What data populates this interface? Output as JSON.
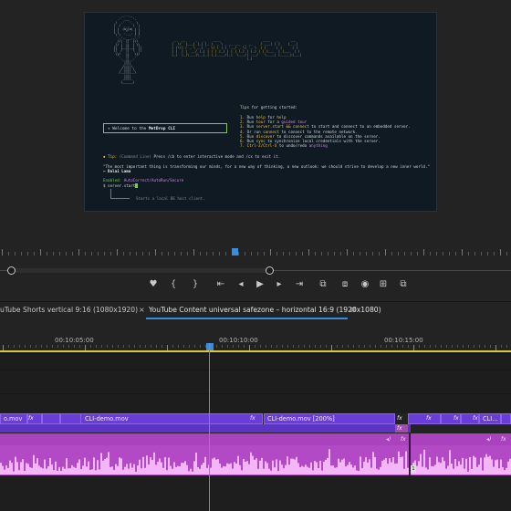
{
  "monitor": {
    "ascii_art": "          .-'''-.\n        .'  ___  '.\n       /  .'   '.  \\\n      |  /  _ _  \\  |\n      | |  (o)(o) | |\n      | |    ^    | |\n       \\ \\  '---' / /\n        '.'-.___.-'.'\n        //|  ||  |\\\\\n       // |  ||  | \\\\\n      ||  |__||__|  ||\n      ||  /  ||  \\  ||\n       \\\\/   ||   \\//\n        '.   ||   .'\n          '-.||.-'\n            ||||\n           /||||\\\n          / |||| \\\n         /__||||__\\\n            ||||\n           _||||_\n          (______)",
    "banner_art": " __  __     _   _    ____                     ____   _      ___ \n|  \\/  |___| |_| |_ |  _ \\ _ __ ___  _ __    / ___| | |    |_ _|\n| |\\/| / _ \\ __| '_ \\| | | | '__/ _ \\| '_ \\  | |     | |     | | \n| |  | |  __/ |_| | | | |_| | | | (_) | |_) | | |___  | |___  | | \n|_|  |_|\\___|\\__|_| |_|____/|_|  \\___/| .__/   \\____| |_____||___|\n                                      |_|                        ",
    "welcome_prefix": "✳ Welcome to the ",
    "welcome_bold": "MetDrop CLI",
    "tips_title": "Tips for getting started:",
    "tips": [
      {
        "n": "1.",
        "a": "Run ",
        "cmd": "help",
        "b": " for ",
        "c": "help",
        "cls": "hi"
      },
      {
        "n": "2.",
        "a": "Run ",
        "cmd": "tour",
        "b": " for a ",
        "c": "guided tour",
        "cls": "pur"
      },
      {
        "n": "3.",
        "a": "Run ",
        "cmd": "server.start && connect",
        "b": " to start and connect to an embedded server.",
        "c": "",
        "cls": ""
      },
      {
        "n": "4.",
        "a": "Or run ",
        "cmd": "connect",
        "b": " to connect to the remote network.",
        "c": "",
        "cls": ""
      },
      {
        "n": "5.",
        "a": "Run ",
        "cmd": "discover",
        "b": " to discover commands available on the server.",
        "c": "",
        "cls": ""
      },
      {
        "n": "6.",
        "a": "Run ",
        "cmd": "sync",
        "b": " to synchronize local credentials with the server.",
        "c": "",
        "cls": ""
      },
      {
        "n": "7.",
        "a": "",
        "cmd": "Ctrl-Z/Ctrl-X",
        "b": " to undo/redo ",
        "c": "anything",
        "cls": "pur"
      }
    ],
    "tip_line_a": "◆ Tip: ",
    "tip_line_b": "(Command Line) ",
    "tip_line_c": "Press /cb to enter interactive mode and /cx to exit it.",
    "quote": "\"The most important thing is transforming our minds, for a new way of thinking, a new outlook: we should strive to develop a new inner world.\"",
    "author": "— Dalai Lama",
    "enabled_label": "Enabled: ",
    "enabled_value": "AutoCorrect/AutoRun/Secure",
    "prompt": "$ server.start",
    "tree_label": "Starts a local BE host client."
  },
  "transport": {
    "icons": [
      "marker-icon",
      "mark-in-icon",
      "mark-out-icon",
      "go-to-in-icon",
      "step-back-icon",
      "play-icon",
      "step-forward-icon",
      "go-to-out-icon",
      "lift-icon",
      "extract-icon",
      "export-frame-icon",
      "compare-icon",
      "settings-icon"
    ],
    "glyphs": [
      "♥",
      "{",
      "}",
      "⇤",
      "◂",
      "▶",
      "▸",
      "⇥",
      "⧉",
      "⧈",
      "◉",
      "⊞",
      "⧉"
    ]
  },
  "timeline": {
    "tabs": [
      {
        "label": "uTube Shorts vertical 9:16 (1080x1920)",
        "active": false
      },
      {
        "label": "YouTube Content universal safezone – horizontal 16:9 (1920x1080)",
        "active": true
      }
    ],
    "close_glyph": "×",
    "menu_glyph": "≡",
    "timecodes": [
      "00:10:05:00",
      "00:10:10:00",
      "00:10:15:00"
    ],
    "video_clips": [
      "o.mov",
      "",
      "",
      "CLI-demo.mov",
      "CLI-demo.mov [200%]",
      "",
      "",
      "",
      "CLI..."
    ],
    "fx_label": "fx",
    "audio_badge": "1"
  }
}
